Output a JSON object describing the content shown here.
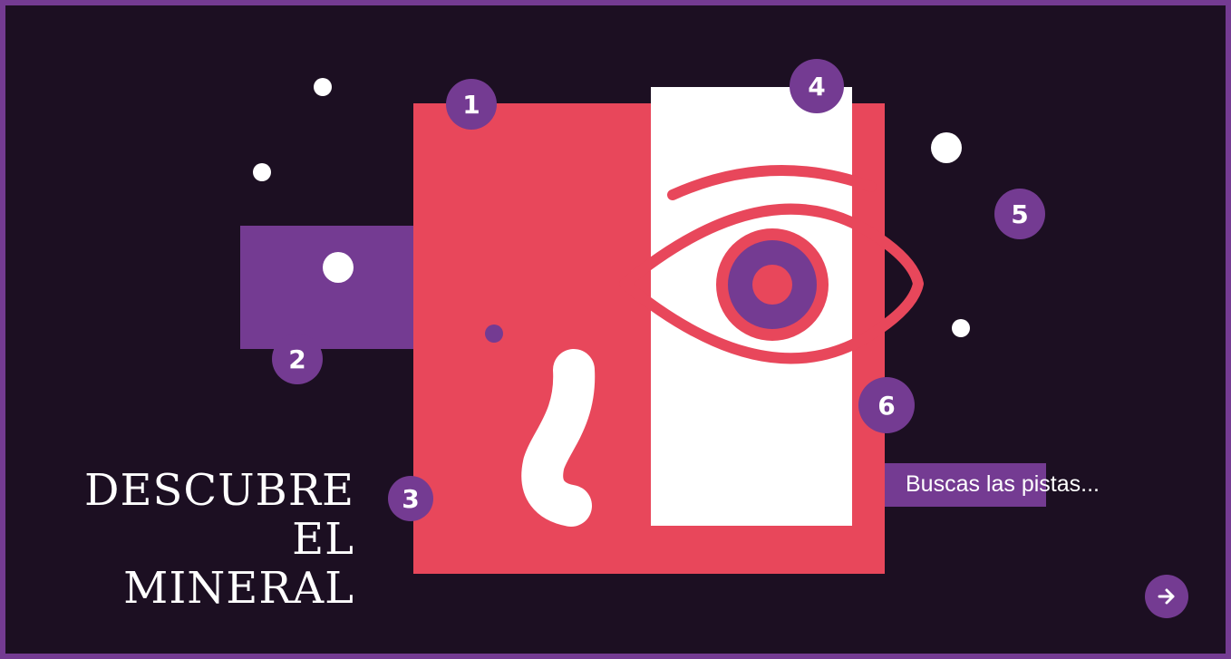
{
  "scene": {
    "title_line1": "DESCUBRE EL",
    "title_line2": "MINERAL",
    "clue_text": "Buscas las pistas...",
    "next_icon": "arrow-right-icon"
  },
  "hotspots": [
    {
      "label": "1"
    },
    {
      "label": "2"
    },
    {
      "label": "3"
    },
    {
      "label": "4"
    },
    {
      "label": "5"
    },
    {
      "label": "6"
    }
  ],
  "colors": {
    "background": "#1c0f22",
    "frame": "#743b92",
    "accent_purple": "#743b92",
    "coral": "#e8475b",
    "white": "#ffffff"
  }
}
